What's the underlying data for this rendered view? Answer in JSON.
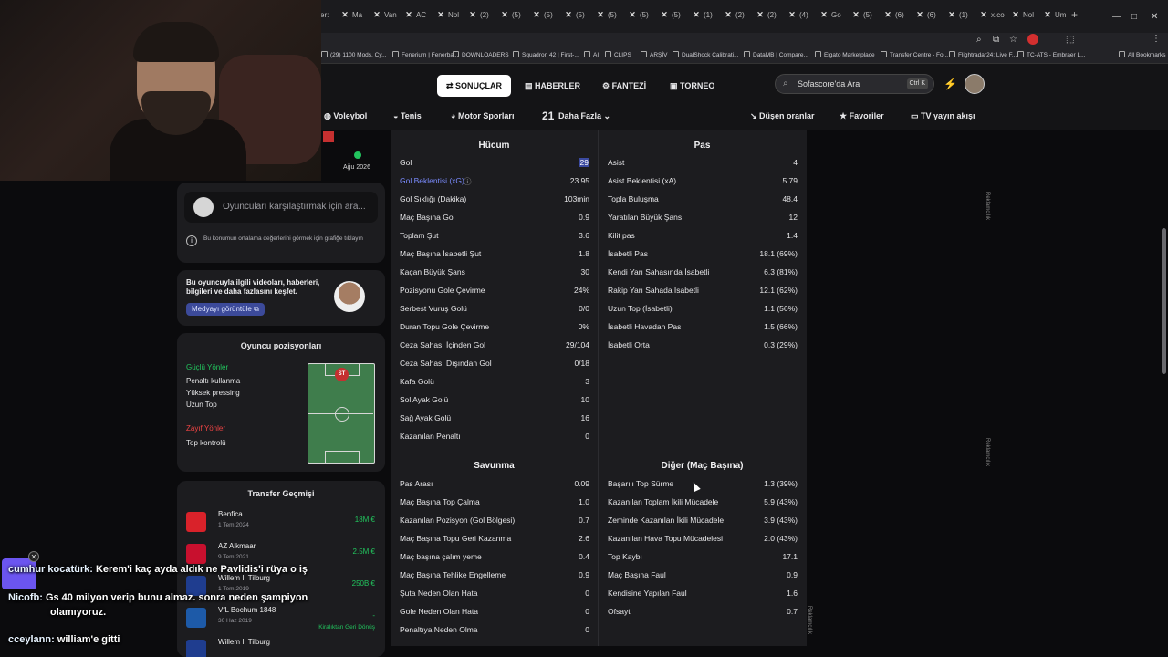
{
  "browser": {
    "tabs": [
      "er:",
      "Ma",
      "Van",
      "AC",
      "Nol",
      "(2)",
      "(5)",
      "(5)",
      "(5)",
      "(5)",
      "(5)",
      "(5)",
      "(1)",
      "(2)",
      "(2)",
      "(4)",
      "Go",
      "(5)",
      "(6)",
      "(6)",
      "(1)",
      "x.co",
      "Nol",
      "Um"
    ],
    "bookmarks": [
      "(29) 1100 Mods. Cy...",
      "Fenerium | Fenerba...",
      "DOWNLOADERS",
      "Squadron 42 | First-...",
      "AI",
      "CLIPS",
      "ARŞİV",
      "DualShock Calibrati...",
      "DataMB | Compare...",
      "Elgato Marketplace",
      "Transfer Centre - Fo...",
      "Flightradar24: Live F...",
      "TC-ATS - Embraer L...",
      "All Bookmarks"
    ]
  },
  "header": {
    "nav": [
      "SONUÇLAR",
      "HABERLER",
      "FANTEZİ",
      "TORNEO"
    ],
    "search_placeholder": "Sofascore'da Ara",
    "search_shortcut": "Ctrl K"
  },
  "subnav": [
    "Voleybol",
    "Tenis",
    "Motor Sporları",
    "21",
    "Daha Fazla",
    "Düşen oranlar",
    "Favoriler",
    "TV yayın akışı"
  ],
  "left": {
    "peek_date": "Ağu 2026",
    "compare_placeholder": "Oyuncuları karşılaştırmak için ara...",
    "compare_note": "Bu konumun ortalama değerlerini görmek için grafiğe tıklayın",
    "media_text": "Bu oyuncuyla ilgili videoları, haberleri, bilgileri ve daha fazlasını keşfet.",
    "media_button": "Medyayı görüntüle",
    "positions_title": "Oyuncu pozisyonları",
    "strong_title": "Güçlü Yönler",
    "strong": [
      "Penaltı kullanma",
      "Yüksek pressing",
      "Uzun Top"
    ],
    "weak_title": "Zayıf Yönler",
    "weak": [
      "Top kontrolü"
    ],
    "pitch_label": "ST",
    "transfers_title": "Transfer Geçmişi",
    "transfers": [
      {
        "club": "Benfica",
        "date": "1 Tem 2024",
        "fee": "18M €",
        "color": "#d9222a"
      },
      {
        "club": "AZ Alkmaar",
        "date": "9 Tem 2021",
        "fee": "2.5M €",
        "color": "#c8102e"
      },
      {
        "club": "Willem II Tilburg",
        "date": "1 Tem 2019",
        "fee": "250B €",
        "color": "#1f3d8f"
      },
      {
        "club": "VfL Bochum 1848",
        "date": "30 Haz 2019",
        "fee": "-",
        "color": "#1d5aa8"
      },
      {
        "club": "Willem II Tilburg",
        "date": "",
        "fee": "",
        "color": "#1f3d8f"
      }
    ],
    "transfer_note": "Kiralıktan Geri Dönüş"
  },
  "chat": [
    {
      "user": "cumhur kocatürk:",
      "msg": "Kerem'i kaç ayda aldık ne Pavlidis'i rüya o iş"
    },
    {
      "user": "Nicofb:",
      "msg": "Gs 40 milyon verip bunu almaz. sonra neden şampiyon"
    },
    {
      "user": "",
      "msg": "olamıyoruz."
    },
    {
      "user": "cceylann:",
      "msg": "william'e gitti"
    }
  ],
  "stats": {
    "attack": {
      "title": "Hücum",
      "rows": [
        [
          "Gol",
          "29"
        ],
        [
          "Gol Beklentisi (xG)",
          "23.95"
        ],
        [
          "Gol Sıklığı (Dakika)",
          "103min"
        ],
        [
          "Maç Başına Gol",
          "0.9"
        ],
        [
          "Toplam Şut",
          "3.6"
        ],
        [
          "Maç Başına İsabetli Şut",
          "1.8"
        ],
        [
          "Kaçan Büyük Şans",
          "30"
        ],
        [
          "Pozisyonu Gole Çevirme",
          "24%"
        ],
        [
          "Serbest Vuruş Golü",
          "0/0"
        ],
        [
          "Duran Topu Gole Çevirme",
          "0%"
        ],
        [
          "Ceza Sahası İçinden Gol",
          "29/104"
        ],
        [
          "Ceza Sahası Dışından Gol",
          "0/18"
        ],
        [
          "Kafa Golü",
          "3"
        ],
        [
          "Sol Ayak Golü",
          "10"
        ],
        [
          "Sağ Ayak Golü",
          "16"
        ],
        [
          "Kazanılan Penaltı",
          "0"
        ]
      ]
    },
    "passing": {
      "title": "Pas",
      "rows": [
        [
          "Asist",
          "4"
        ],
        [
          "Asist Beklentisi (xA)",
          "5.79"
        ],
        [
          "Topla Buluşma",
          "48.4"
        ],
        [
          "Yaratılan Büyük Şans",
          "12"
        ],
        [
          "Kilit pas",
          "1.4"
        ],
        [
          "İsabetli Pas",
          "18.1 (69%)"
        ],
        [
          "Kendi Yarı Sahasında İsabetli",
          "6.3 (81%)"
        ],
        [
          "Rakip Yarı Sahada İsabetli",
          "12.1 (62%)"
        ],
        [
          "Uzun Top (İsabetli)",
          "1.1 (56%)"
        ],
        [
          "İsabetli Havadan Pas",
          "1.5 (66%)"
        ],
        [
          "İsabetli Orta",
          "0.3 (29%)"
        ]
      ]
    },
    "defense": {
      "title": "Savunma",
      "rows": [
        [
          "Pas Arası",
          "0.09"
        ],
        [
          "Maç Başına Top Çalma",
          "1.0"
        ],
        [
          "Kazanılan Pozisyon (Gol Bölgesi)",
          "0.7"
        ],
        [
          "Maç Başına Topu Geri Kazanma",
          "2.6"
        ],
        [
          "Maç başına çalım yeme",
          "0.4"
        ],
        [
          "Maç Başına Tehlike Engelleme",
          "0.9"
        ],
        [
          "Şuta Neden Olan Hata",
          "0"
        ],
        [
          "Gole Neden Olan Hata",
          "0"
        ],
        [
          "Penaltıya Neden Olma",
          "0"
        ]
      ]
    },
    "other": {
      "title": "Diğer (Maç Başına)",
      "rows": [
        [
          "Başarılı Top Sürme",
          "1.3 (39%)"
        ],
        [
          "Kazanılan Toplam İkili Mücadele",
          "5.9 (43%)"
        ],
        [
          "Zeminde Kazanılan İkili Mücadele",
          "3.9 (43%)"
        ],
        [
          "Kazanılan Hava Topu Mücadelesi",
          "2.0 (43%)"
        ],
        [
          "Top Kaybı",
          "17.1"
        ],
        [
          "Maç Başına Faul",
          "0.9"
        ],
        [
          "Kendisine Yapılan Faul",
          "1.6"
        ],
        [
          "Ofsayt",
          "0.7"
        ]
      ]
    }
  },
  "ad_label": "Reklamcılık"
}
